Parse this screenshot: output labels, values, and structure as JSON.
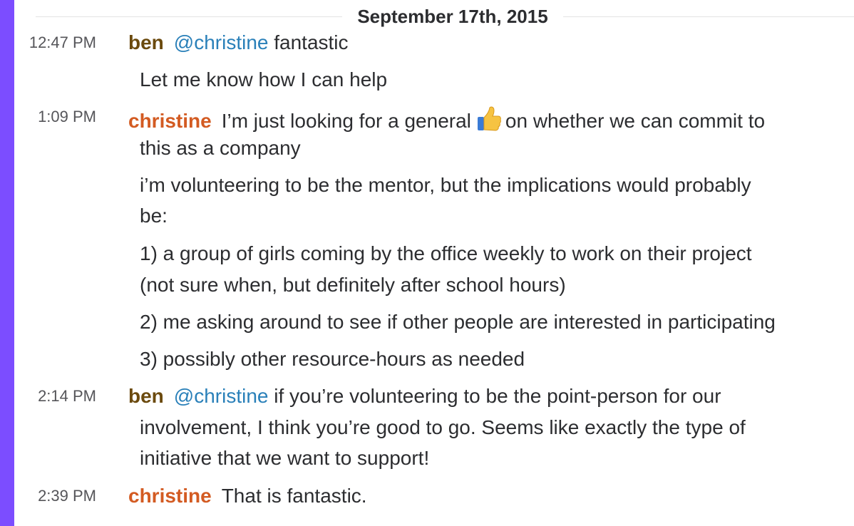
{
  "date_divider": "September 17th, 2015",
  "messages": [
    {
      "time": "12:47 PM",
      "author": "ben",
      "mention": "@christine",
      "text": "fantastic"
    },
    {
      "text": "Let me know how I can help"
    },
    {
      "time": "1:09 PM",
      "author": "christine",
      "text_before_emoji": "I’m just looking for a general",
      "emoji": "thumbs-up-icon",
      "text_after_emoji": "on whether we can commit to",
      "continuation": "this as a company"
    },
    {
      "lines": [
        "i’m volunteering to be the mentor, but the implications would probably",
        "be:"
      ]
    },
    {
      "lines": [
        "1) a group of girls coming by the office weekly to work on their project",
        "(not sure when, but definitely after school hours)"
      ]
    },
    {
      "text": "2) me asking around to see if other people are interested in participating"
    },
    {
      "text": "3) possibly other resource-hours as needed"
    },
    {
      "time": "2:14 PM",
      "author": "ben",
      "mention": "@christine",
      "text": "if you’re volunteering to be the point-person for our",
      "continuation": [
        "involvement, I think you’re good to go. Seems like exactly the type of",
        "initiative that we want to support!"
      ]
    },
    {
      "time": "2:39 PM",
      "author": "christine",
      "text": "That is fantastic."
    }
  ],
  "colors": {
    "accent_bar": "#7c4dff",
    "ben": "#6b4a0e",
    "christine": "#d35b22",
    "mention": "#2a80b9"
  }
}
